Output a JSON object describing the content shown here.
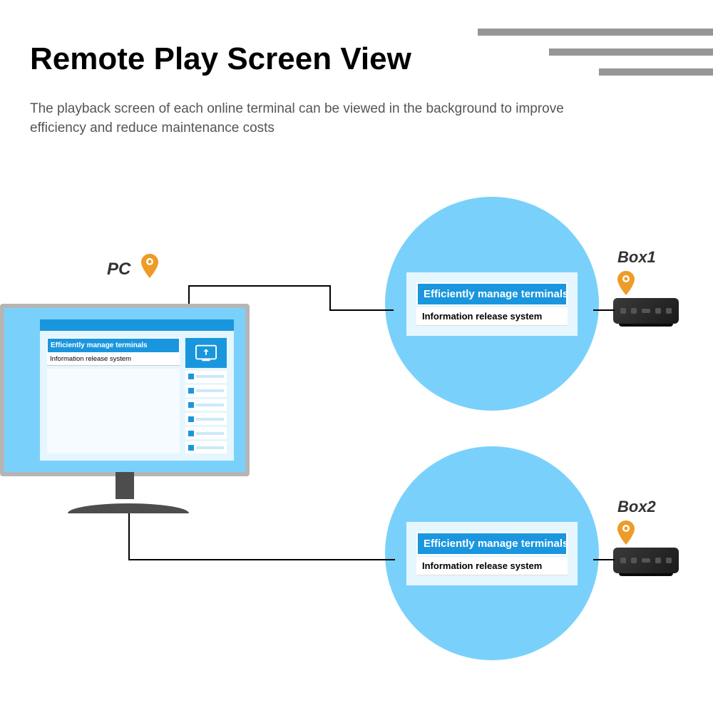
{
  "title": "Remote Play Screen View",
  "subtitle": "The playback screen of each online terminal can be viewed in the background to improve efficiency and reduce maintenance costs",
  "pc_label": "PC",
  "card": {
    "banner": "Efficiently manage terminals",
    "sub": "Information release system"
  },
  "boxes": [
    {
      "label": "Box1"
    },
    {
      "label": "Box2"
    }
  ],
  "colors": {
    "light_blue": "#79d1fb",
    "deep_blue": "#1a96de",
    "pin": "#ed9c28"
  }
}
